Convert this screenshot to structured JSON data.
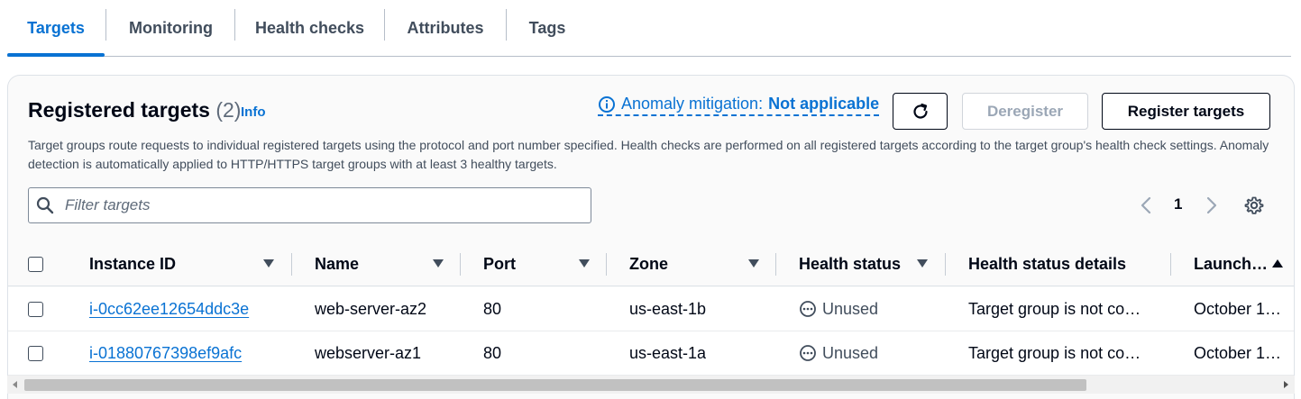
{
  "tabs": [
    {
      "label": "Targets",
      "active": true
    },
    {
      "label": "Monitoring"
    },
    {
      "label": "Health checks"
    },
    {
      "label": "Attributes"
    },
    {
      "label": "Tags"
    }
  ],
  "header": {
    "title": "Registered targets",
    "count": "(2)",
    "info": "Info",
    "anomaly_prefix": "Anomaly mitigation:",
    "anomaly_value": "Not applicable",
    "deregister": "Deregister",
    "register": "Register targets",
    "description": "Target groups route requests to individual registered targets using the protocol and port number specified. Health checks are performed on all registered targets according to the target group's health check settings. Anomaly detection is automatically applied to HTTP/HTTPS target groups with at least 3 healthy targets."
  },
  "filter": {
    "placeholder": "Filter targets"
  },
  "pagination": {
    "page": "1"
  },
  "table": {
    "columns": [
      "Instance ID",
      "Name",
      "Port",
      "Zone",
      "Health status",
      "Health status details",
      "Launch…"
    ],
    "rows": [
      {
        "instance_id": "i-0cc62ee12654ddc3e",
        "name": "web-server-az2",
        "port": "80",
        "zone": "us-east-1b",
        "health": "Unused",
        "details": "Target group is not co…",
        "launch": "October 1…"
      },
      {
        "instance_id": "i-01880767398ef9afc",
        "name": "webserver-az1",
        "port": "80",
        "zone": "us-east-1a",
        "health": "Unused",
        "details": "Target group is not co…",
        "launch": "October 1…"
      }
    ]
  },
  "colors": {
    "accent": "#0972d3",
    "text": "#000716",
    "muted": "#414d5c"
  }
}
